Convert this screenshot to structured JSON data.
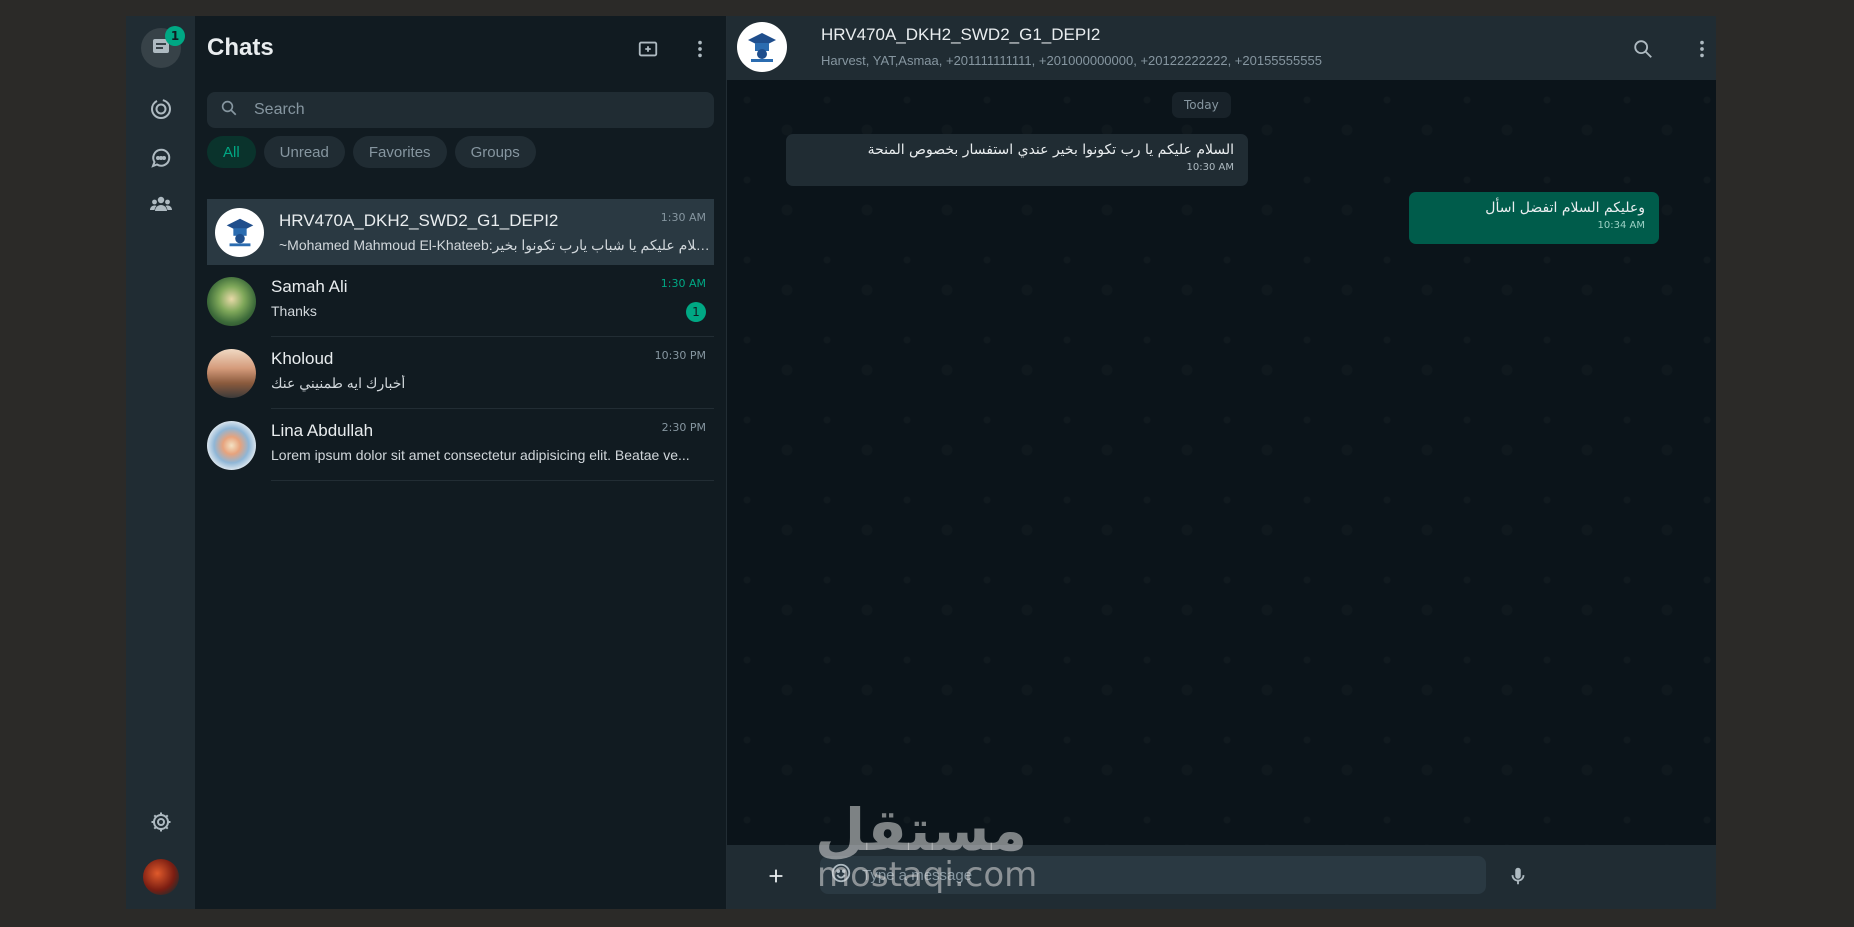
{
  "rail": {
    "chats_badge": "1",
    "items": [
      "chats",
      "status",
      "channels",
      "communities"
    ]
  },
  "chatlist": {
    "title": "Chats",
    "search_placeholder": "Search",
    "filters": [
      "All",
      "Unread",
      "Favorites",
      "Groups"
    ],
    "chats": [
      {
        "name": "HRV470A_DKH2_SWD2_G1_DEPI2",
        "time": "1:30 AM",
        "preview": "~Mohamed Mahmoud El-Khateeb:السلام عليكم يا شباب يارب تكونوا بخير"
      },
      {
        "name": "Samah Ali",
        "time": "1:30 AM",
        "preview": "Thanks",
        "unread": "1"
      },
      {
        "name": "Kholoud",
        "time": "10:30 PM",
        "preview": "أخبارك ايه طمنيني عنك"
      },
      {
        "name": "Lina Abdullah",
        "time": "2:30 PM",
        "preview": "Lorem ipsum dolor sit amet consectetur adipisicing elit. Beatae ve..."
      }
    ]
  },
  "conversation": {
    "name": "HRV470A_DKH2_SWD2_G1_DEPI2",
    "members": "Harvest, YAT,Asmaa, +201111111111, +201000000000, +20122222222, +20155555555",
    "date_chip": "Today",
    "messages": [
      {
        "dir": "in",
        "text": "السلام عليكم يا رب تكونوا بخير عندي استفسار بخصوص المنحة",
        "time": "10:30 AM"
      },
      {
        "dir": "out",
        "text": "وعليكم السلام اتفضل اسأل",
        "time": "10:34 AM"
      }
    ],
    "input_placeholder": "Type a message"
  },
  "watermark": {
    "arabic": "مستقل",
    "latin": "mostaqi.com"
  },
  "colors": {
    "accent": "#00a884",
    "panel": "#202c33",
    "background": "#111b21",
    "outgoing_bubble": "#005c4b"
  }
}
